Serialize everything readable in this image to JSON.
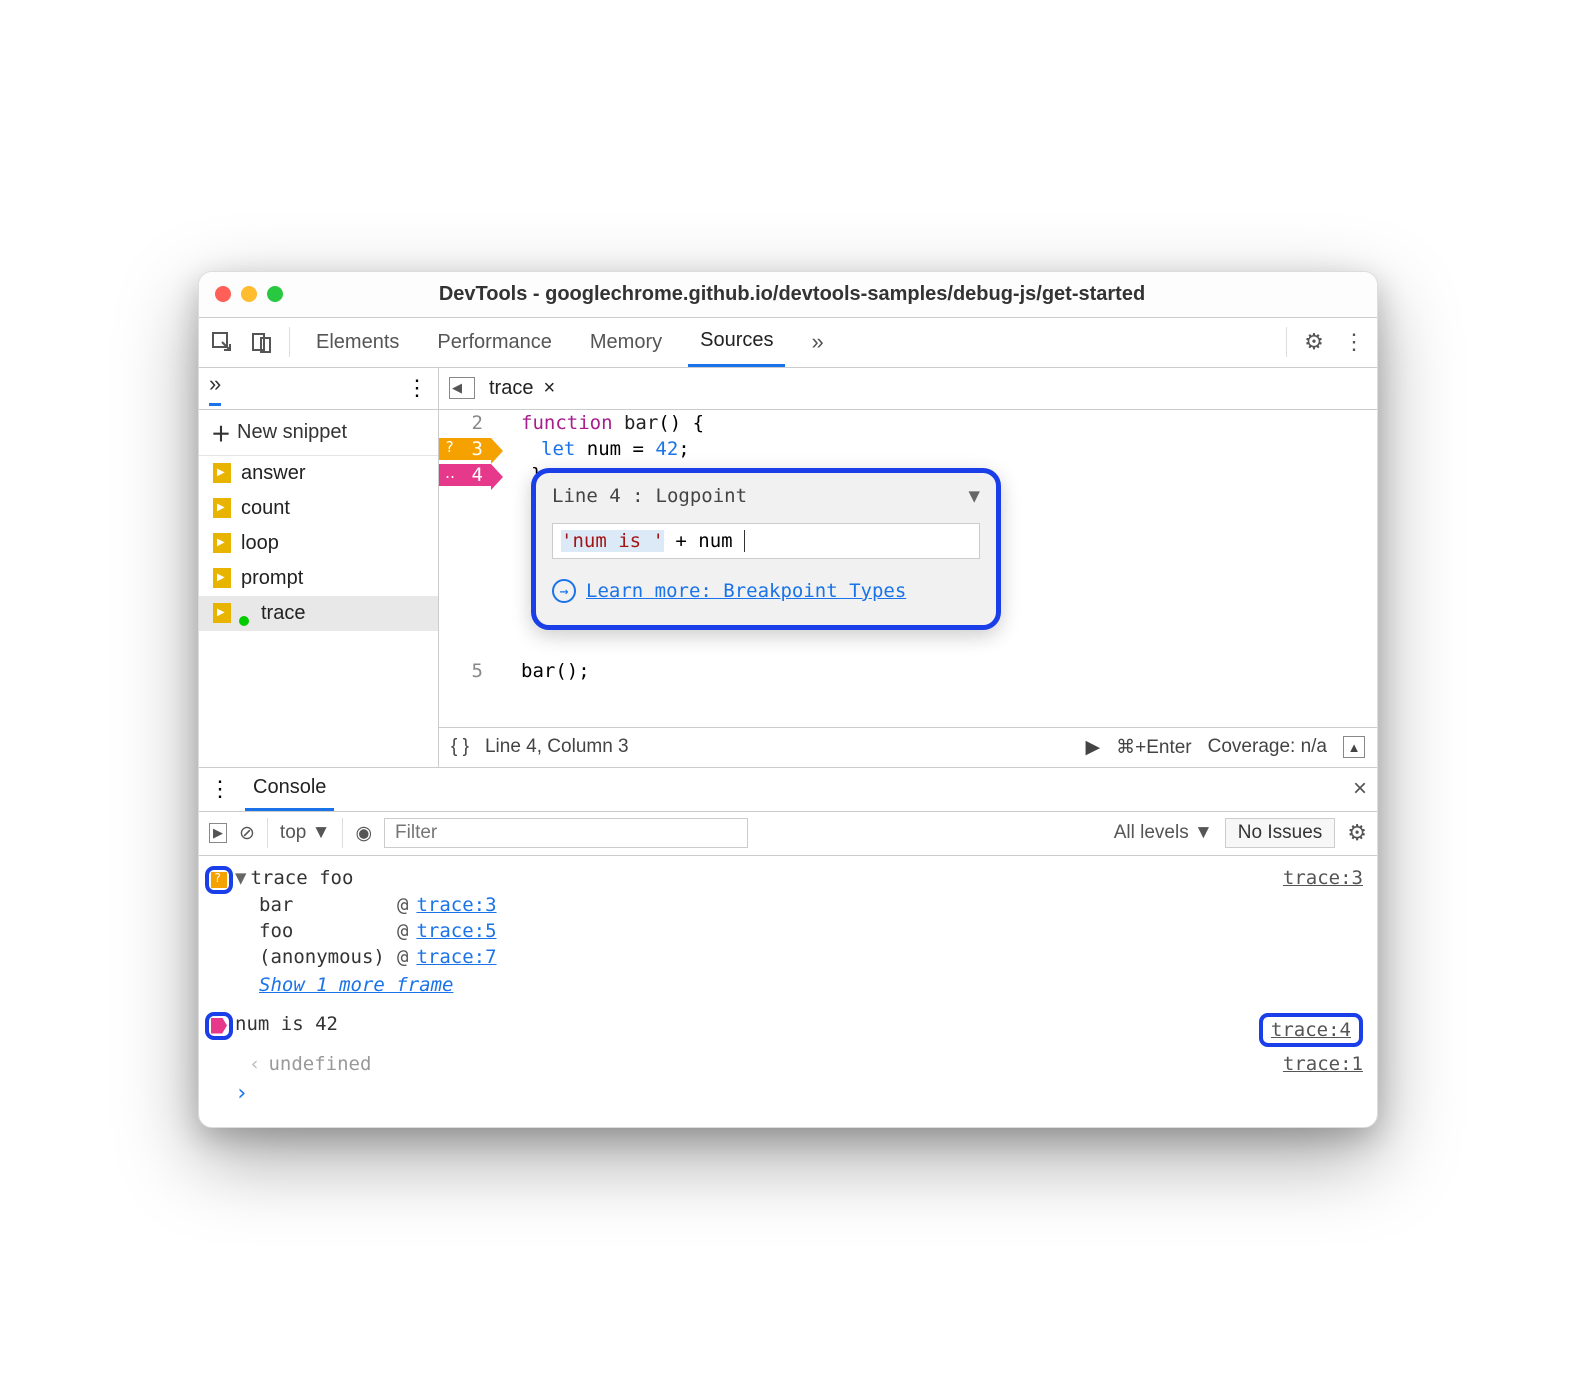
{
  "window": {
    "title": "DevTools - googlechrome.github.io/devtools-samples/debug-js/get-started"
  },
  "toolbar": {
    "tabs": {
      "elements": "Elements",
      "performance": "Performance",
      "memory": "Memory",
      "sources": "Sources"
    },
    "more": "»"
  },
  "sidebar": {
    "new_snippet": "New snippet",
    "items": [
      {
        "label": "answer"
      },
      {
        "label": "count"
      },
      {
        "label": "loop"
      },
      {
        "label": "prompt"
      },
      {
        "label": "trace",
        "selected": true
      }
    ]
  },
  "editor": {
    "tab": {
      "name": "trace",
      "close": "×"
    },
    "lines": {
      "l2": {
        "n": "2",
        "code_kw": "function",
        "code_fn": " bar",
        "code_rest": "() {"
      },
      "l3": {
        "n": "3",
        "mark": "?",
        "code_let": "let",
        "code_rest": " num = ",
        "code_num": "42",
        "code_semi": ";"
      },
      "l4": {
        "n": "4",
        "mark": "‥",
        "code": "}"
      },
      "l5": {
        "n": "5",
        "code": "bar();"
      }
    },
    "popup": {
      "line_label": "Line 4 :",
      "type": "Logpoint",
      "expr_str": "'num is '",
      "expr_rest": " + num",
      "learn": "Learn more: Breakpoint Types"
    },
    "statusbar": {
      "braces": "{ }",
      "pos": "Line 4, Column 3",
      "run_hint": "⌘+Enter",
      "coverage": "Coverage: n/a"
    }
  },
  "console": {
    "tab": "Console",
    "context": "top",
    "filter_ph": "Filter",
    "levels": "All levels",
    "issues": "No Issues",
    "log1": {
      "text": "trace foo",
      "src": "trace:3"
    },
    "stack": [
      {
        "fn": "bar",
        "at": "@",
        "link": "trace:3"
      },
      {
        "fn": "foo",
        "at": "@",
        "link": "trace:5"
      },
      {
        "fn": "(anonymous)",
        "at": "@",
        "link": "trace:7"
      }
    ],
    "show_more": "Show 1 more frame",
    "log2": {
      "text": "num is 42",
      "src": "trace:4"
    },
    "undef": {
      "sym": "‹",
      "text": "undefined",
      "src": "trace:1"
    },
    "prompt": "›"
  }
}
